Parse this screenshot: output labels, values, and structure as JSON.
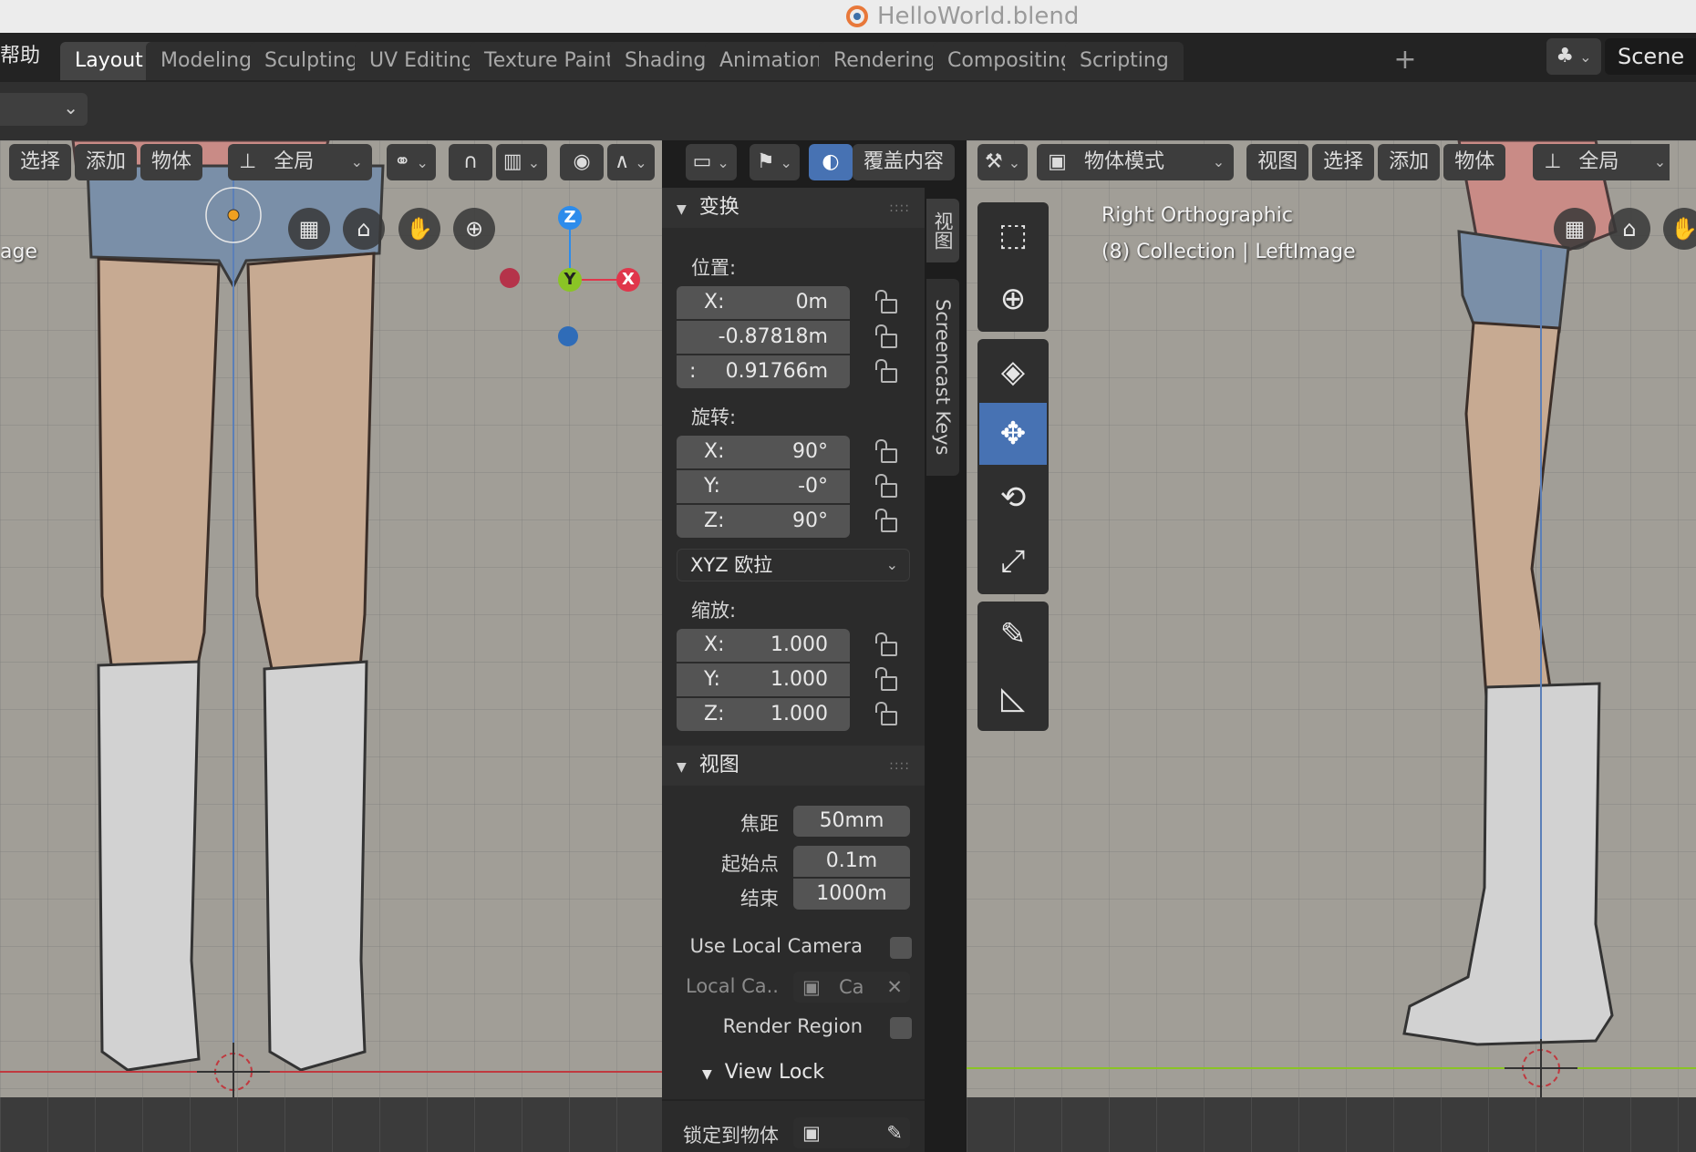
{
  "window": {
    "title": "HelloWorld.blend"
  },
  "menu": {
    "help_fragment": "帮助"
  },
  "workspace_tabs": [
    "Layout",
    "Modeling",
    "Sculpting",
    "UV Editing",
    "Texture Paint",
    "Shading",
    "Animation",
    "Rendering",
    "Compositing",
    "Scripting"
  ],
  "workspace_add": "+",
  "scene": {
    "name": "Scene"
  },
  "left_viewport": {
    "header": {
      "select": "选择",
      "add": "添加",
      "object": "物体",
      "orientation": "全局",
      "overlays": "覆盖内容"
    },
    "overlay_text": "age",
    "gizmo": {
      "z": "Z",
      "y": "Y",
      "x": "X"
    }
  },
  "right_viewport": {
    "header": {
      "mode": "物体模式",
      "view": "视图",
      "select": "选择",
      "add": "添加",
      "object": "物体",
      "orientation": "全局"
    },
    "view_name": "Right Orthographic",
    "collection_info": "(8) Collection | LeftImage"
  },
  "side_tabs": {
    "view_tab": "视图",
    "screencast_tab": "Screencast Keys"
  },
  "npanel": {
    "transform": {
      "title": "变换",
      "location_label": "位置:",
      "location": [
        {
          "axis": "X:",
          "value": "0m"
        },
        {
          "axis": "",
          "value": "-0.87818m"
        },
        {
          "axis": ":",
          "value": "0.91766m"
        }
      ],
      "rotation_label": "旋转:",
      "rotation": [
        {
          "axis": "X:",
          "value": "90°"
        },
        {
          "axis": "Y:",
          "value": "-0°"
        },
        {
          "axis": "Z:",
          "value": "90°"
        }
      ],
      "rotation_mode": "XYZ 欧拉",
      "scale_label": "缩放:",
      "scale": [
        {
          "axis": "X:",
          "value": "1.000"
        },
        {
          "axis": "Y:",
          "value": "1.000"
        },
        {
          "axis": "Z:",
          "value": "1.000"
        }
      ]
    },
    "view": {
      "title": "视图",
      "focal_length_label": "焦距",
      "focal_length": "50mm",
      "clip_start_label": "起始点",
      "clip_start": "0.1m",
      "clip_end_label": "结束",
      "clip_end": "1000m",
      "use_local_camera": "Use Local Camera",
      "local_camera_label": "Local Ca..",
      "local_camera_value": "Ca",
      "render_region": "Render Region",
      "view_lock": "View Lock",
      "lock_to_object": "锁定到物体"
    }
  },
  "colors": {
    "accent": "#4772b3",
    "axis_x": "#e0364b",
    "axis_y": "#8ac425",
    "axis_z": "#2d8ceb",
    "viewport_bg": "#a19e97"
  }
}
